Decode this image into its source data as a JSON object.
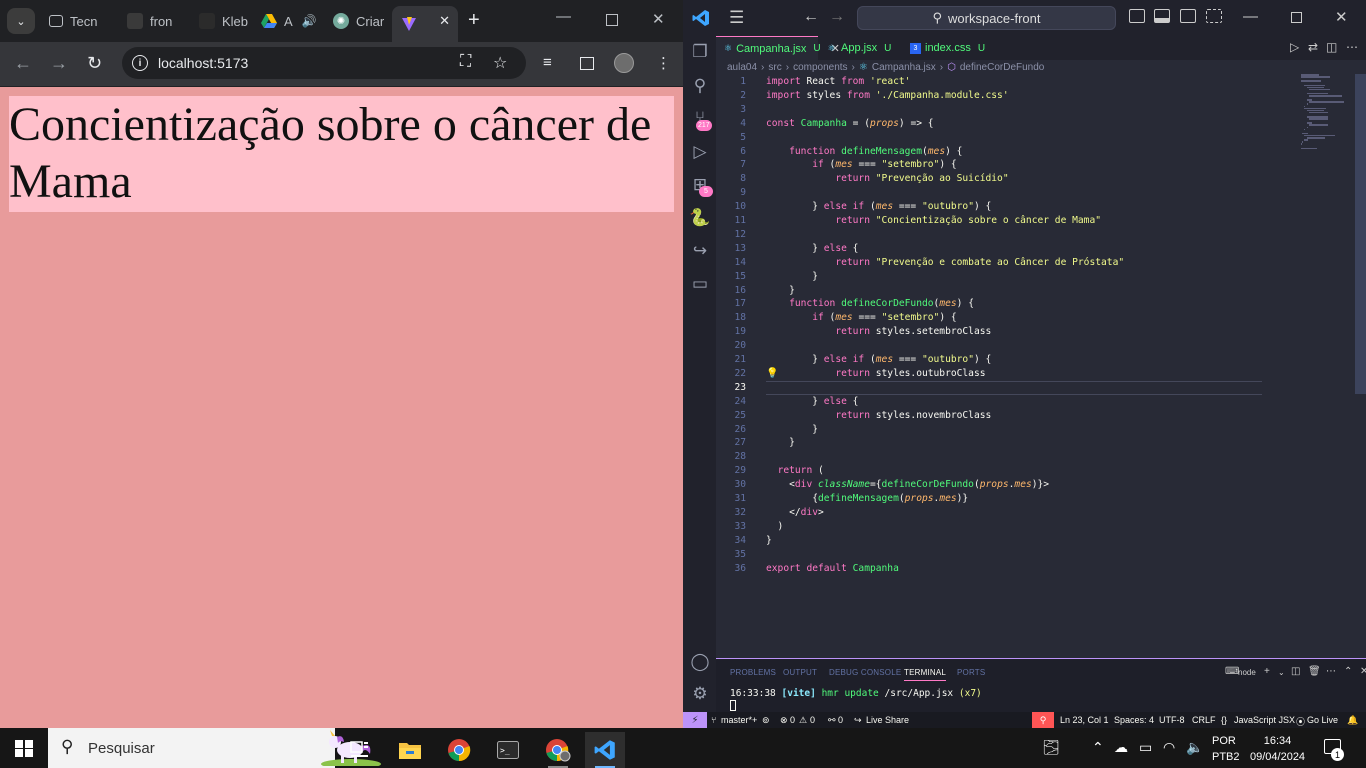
{
  "browser": {
    "tabs": [
      {
        "title": "Tecn"
      },
      {
        "title": "fron"
      },
      {
        "title": "Kleb"
      },
      {
        "title": "A"
      },
      {
        "title": "Criar"
      },
      {
        "title": ""
      }
    ],
    "url": "localhost:5173",
    "page": {
      "heading": "Concientização sobre o câncer de Mama"
    }
  },
  "vscode": {
    "command_center": "workspace-front",
    "tabs": [
      {
        "name": "Campanha.jsx",
        "status": "U",
        "active": true
      },
      {
        "name": "App.jsx",
        "status": "U"
      },
      {
        "name": "index.css",
        "status": "U"
      }
    ],
    "breadcrumb": [
      "aula04",
      "src",
      "components",
      "Campanha.jsx",
      "defineCorDeFundo"
    ],
    "source_control_badge": "217",
    "extensions_badge": "5",
    "code_lines": [
      "import React from 'react'",
      "import styles from './Campanha.module.css'",
      "",
      "const Campanha = (props) => {",
      "",
      "    function defineMensagem(mes) {",
      "        if (mes === \"setembro\") {",
      "            return \"Prevenção ao Suicídio\"",
      "",
      "        } else if (mes === \"outubro\") {",
      "            return \"Concientização sobre o câncer de Mama\"",
      "",
      "        } else {",
      "            return \"Prevenção e combate ao Câncer de Próstata\"",
      "        }",
      "    }",
      "    function defineCorDeFundo(mes) {",
      "        if (mes === \"setembro\") {",
      "            return styles.setembroClass",
      "",
      "        } else if (mes === \"outubro\") {",
      "            return styles.outubroClass",
      "",
      "        } else {",
      "            return styles.novembroClass",
      "        }",
      "    }",
      "",
      "  return (",
      "    <div className={defineCorDeFundo(props.mes)}>",
      "        {defineMensagem(props.mes)}",
      "    </div>",
      "  )",
      "}",
      "",
      "export default Campanha"
    ],
    "current_line": 23,
    "panel": {
      "tabs": [
        "PROBLEMS",
        "OUTPUT",
        "DEBUG CONSOLE",
        "TERMINAL",
        "PORTS"
      ],
      "active_tab": "TERMINAL",
      "shell": "node",
      "terminal_output": {
        "time": "16:33:38",
        "tag": "[vite]",
        "msg": "hmr update",
        "path": "/src/App.jsx",
        "count": "(x7)"
      }
    },
    "status": {
      "branch": "master*+",
      "errors": "0",
      "warnings": "0",
      "ports": "0",
      "live_share": "Live Share",
      "position": "Ln 23, Col 1",
      "spaces": "Spaces: 4",
      "encoding": "UTF-8",
      "eol": "CRLF",
      "language": "JavaScript JSX",
      "go_live": "Go Live"
    }
  },
  "taskbar": {
    "search_placeholder": "Pesquisar",
    "lang_top": "POR",
    "lang_bottom": "PTB2",
    "time": "16:34",
    "date": "09/04/2024",
    "notifications": "1"
  }
}
